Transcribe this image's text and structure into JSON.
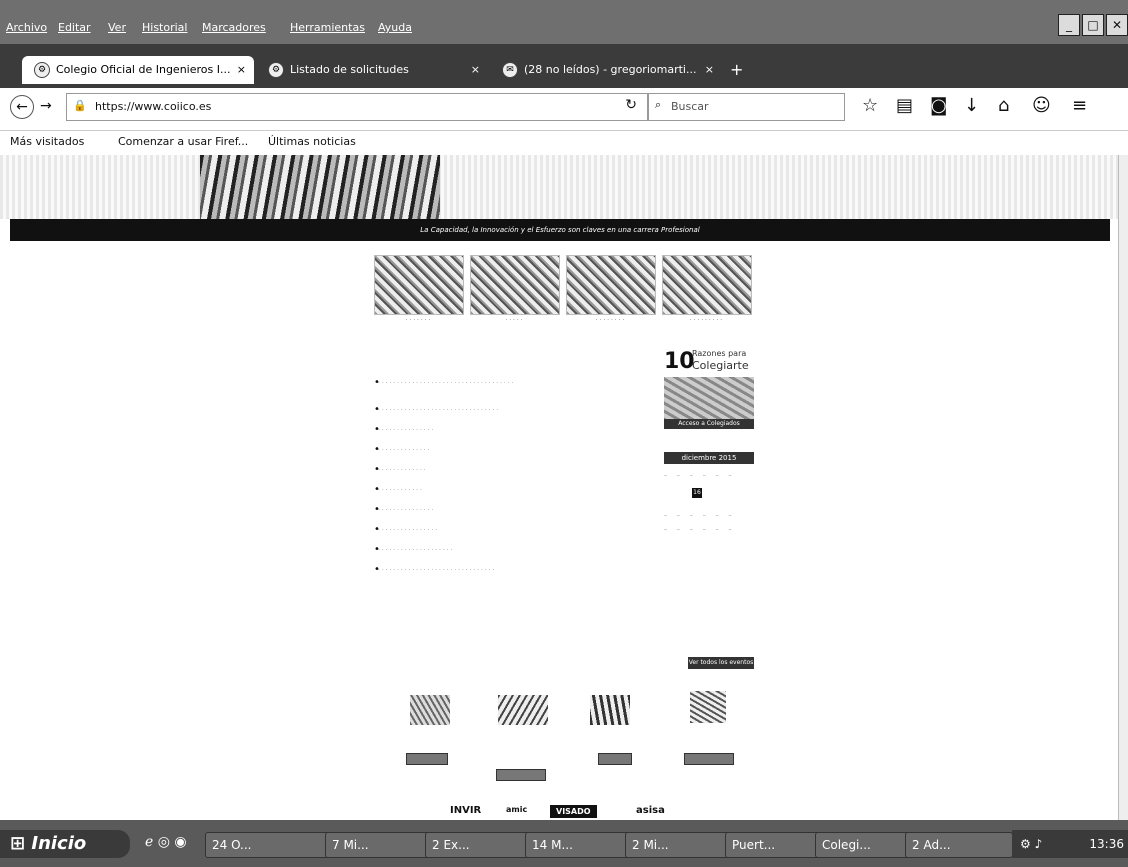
{
  "menubar": {
    "items": [
      "Archivo",
      "Editar",
      "Ver",
      "Historial",
      "Marcadores",
      "Herramientas",
      "Ayuda"
    ]
  },
  "tabs": [
    {
      "label": "Colegio Oficial de Ingenieros I...",
      "close": "×"
    },
    {
      "label": "Listado de solicitudes",
      "close": "×"
    },
    {
      "label": "(28 no leídos) - gregoriomarti...",
      "close": "×"
    },
    {
      "label": "+"
    }
  ],
  "nav": {
    "url": "https://www.coiico.es",
    "search_placeholder": "Buscar"
  },
  "bookmarks": [
    "Más visitados",
    "Comenzar a usar Firef...",
    "Últimas noticias"
  ],
  "page": {
    "banner_tagline": "La Capacidad, la Innovación y el Esfuerzo son claves en una carrera Profesional",
    "razones": {
      "number": "10",
      "line1": "Razones para",
      "line2": "Colegiarte"
    },
    "acceso": "Acceso a Colegiados",
    "calendar_month": "diciembre 2015",
    "calendar_today": "16",
    "all_events_button": "Ver todos los eventos",
    "logos": [
      "INVIR",
      "amic",
      "VISADO",
      "asisa"
    ]
  },
  "taskbar": {
    "start": "Inicio",
    "tasks": [
      "24 O...",
      "7 Mi...",
      "2 Ex...",
      "14 M...",
      "2 Mi...",
      "Puert...",
      "Colegi...",
      "2 Ad..."
    ],
    "clock": "13:36"
  },
  "colors": {
    "chrome": "#6f6f6f",
    "tabs": "#3b3b3b",
    "banner_bar": "#111111"
  }
}
